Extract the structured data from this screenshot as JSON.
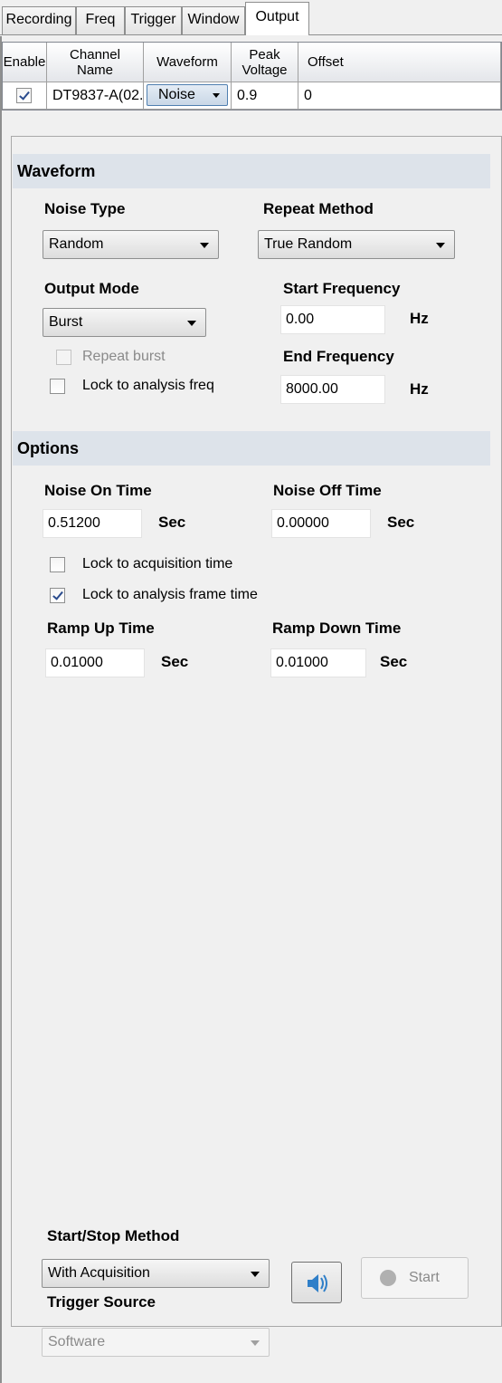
{
  "tabs": [
    "Recording",
    "Freq",
    "Trigger",
    "Window",
    "Output"
  ],
  "grid": {
    "headers": [
      "Enable",
      "Channel Name",
      "Waveform",
      "Peak Voltage",
      "Offset"
    ],
    "row": {
      "enabled": true,
      "channel_name": "DT9837-A(02...",
      "waveform": "Noise",
      "peak_voltage": "0.9",
      "offset": "0"
    }
  },
  "waveform_section": {
    "title": "Waveform",
    "noise_type_label": "Noise Type",
    "noise_type_value": "Random",
    "repeat_method_label": "Repeat Method",
    "repeat_method_value": "True Random",
    "output_mode_label": "Output Mode",
    "output_mode_value": "Burst",
    "start_frequency_label": "Start Frequency",
    "start_frequency_value": "0.00",
    "end_frequency_label": "End Frequency",
    "end_frequency_value": "8000.00",
    "hz_unit": "Hz",
    "repeat_burst_label": "Repeat burst",
    "repeat_burst_checked": false,
    "lock_analysis_freq_label": "Lock to analysis freq",
    "lock_analysis_freq_checked": false
  },
  "options_section": {
    "title": "Options",
    "noise_on_label": "Noise On Time",
    "noise_on_value": "0.51200",
    "noise_off_label": "Noise Off Time",
    "noise_off_value": "0.00000",
    "sec_unit": "Sec",
    "lock_acq_label": "Lock to acquisition time",
    "lock_acq_checked": false,
    "lock_frame_label": "Lock to analysis frame time",
    "lock_frame_checked": true,
    "ramp_up_label": "Ramp Up Time",
    "ramp_up_value": "0.01000",
    "ramp_down_label": "Ramp Down Time",
    "ramp_down_value": "0.01000"
  },
  "bottom": {
    "start_stop_label": "Start/Stop Method",
    "start_stop_value": "With Acquisition",
    "trigger_source_label": "Trigger Source",
    "trigger_source_value": "Software",
    "start_button_label": "Start",
    "speaker_icon": "speaker-icon",
    "record_dot_icon": "record-dot-icon"
  },
  "colors": {
    "section_header_bg": "#dde3ea",
    "speaker_blue": "#2f7fc8"
  }
}
